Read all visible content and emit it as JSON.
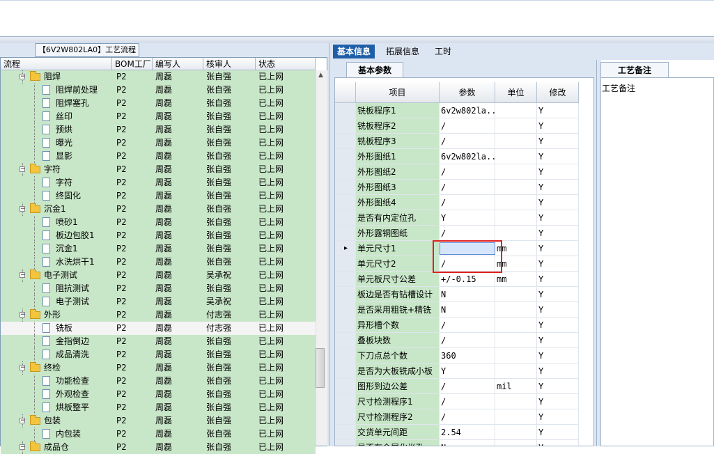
{
  "left_panel": {
    "tab_title": "【6V2W802LA0】工艺流程",
    "columns": [
      "流程",
      "BOM工厂",
      "编写人",
      "核审人",
      "状态"
    ],
    "rows": [
      {
        "name": "阻焊",
        "level": 1,
        "type": "folder",
        "bom": "P2",
        "writer": "周磊",
        "reviewer": "张自强",
        "status": "已上网"
      },
      {
        "name": "阻焊前处理",
        "level": 2,
        "type": "doc",
        "bom": "P2",
        "writer": "周磊",
        "reviewer": "张自强",
        "status": "已上网"
      },
      {
        "name": "阻焊塞孔",
        "level": 2,
        "type": "doc",
        "bom": "P2",
        "writer": "周磊",
        "reviewer": "张自强",
        "status": "已上网"
      },
      {
        "name": "丝印",
        "level": 2,
        "type": "doc",
        "bom": "P2",
        "writer": "周磊",
        "reviewer": "张自强",
        "status": "已上网"
      },
      {
        "name": "预烘",
        "level": 2,
        "type": "doc",
        "bom": "P2",
        "writer": "周磊",
        "reviewer": "张自强",
        "status": "已上网"
      },
      {
        "name": "曝光",
        "level": 2,
        "type": "doc",
        "bom": "P2",
        "writer": "周磊",
        "reviewer": "张自强",
        "status": "已上网"
      },
      {
        "name": "显影",
        "level": 2,
        "type": "doc",
        "bom": "P2",
        "writer": "周磊",
        "reviewer": "张自强",
        "status": "已上网"
      },
      {
        "name": "字符",
        "level": 1,
        "type": "folder",
        "bom": "P2",
        "writer": "周磊",
        "reviewer": "张自强",
        "status": "已上网"
      },
      {
        "name": "字符",
        "level": 2,
        "type": "doc",
        "bom": "P2",
        "writer": "周磊",
        "reviewer": "张自强",
        "status": "已上网"
      },
      {
        "name": "终固化",
        "level": 2,
        "type": "doc",
        "bom": "P2",
        "writer": "周磊",
        "reviewer": "张自强",
        "status": "已上网"
      },
      {
        "name": "沉金1",
        "level": 1,
        "type": "folder",
        "bom": "P2",
        "writer": "周磊",
        "reviewer": "张自强",
        "status": "已上网"
      },
      {
        "name": "喷砂1",
        "level": 2,
        "type": "doc",
        "bom": "P2",
        "writer": "周磊",
        "reviewer": "张自强",
        "status": "已上网"
      },
      {
        "name": "板边包胶1",
        "level": 2,
        "type": "doc",
        "bom": "P2",
        "writer": "周磊",
        "reviewer": "张自强",
        "status": "已上网"
      },
      {
        "name": "沉金1",
        "level": 2,
        "type": "doc",
        "bom": "P2",
        "writer": "周磊",
        "reviewer": "张自强",
        "status": "已上网"
      },
      {
        "name": "水洗烘干1",
        "level": 2,
        "type": "doc",
        "bom": "P2",
        "writer": "周磊",
        "reviewer": "张自强",
        "status": "已上网"
      },
      {
        "name": "电子测试",
        "level": 1,
        "type": "folder",
        "bom": "P2",
        "writer": "周磊",
        "reviewer": "吴承祝",
        "status": "已上网"
      },
      {
        "name": "阻抗测试",
        "level": 2,
        "type": "doc",
        "bom": "P2",
        "writer": "周磊",
        "reviewer": "张自强",
        "status": "已上网"
      },
      {
        "name": "电子测试",
        "level": 2,
        "type": "doc",
        "bom": "P2",
        "writer": "周磊",
        "reviewer": "吴承祝",
        "status": "已上网"
      },
      {
        "name": "外形",
        "level": 1,
        "type": "folder",
        "bom": "P2",
        "writer": "周磊",
        "reviewer": "付志强",
        "status": "已上网"
      },
      {
        "name": "铣板",
        "level": 2,
        "type": "doc",
        "bom": "P2",
        "writer": "周磊",
        "reviewer": "付志强",
        "status": "已上网",
        "selected": true
      },
      {
        "name": "金指倒边",
        "level": 2,
        "type": "doc",
        "bom": "P2",
        "writer": "周磊",
        "reviewer": "张自强",
        "status": "已上网"
      },
      {
        "name": "成品清洗",
        "level": 2,
        "type": "doc",
        "bom": "P2",
        "writer": "周磊",
        "reviewer": "张自强",
        "status": "已上网"
      },
      {
        "name": "终检",
        "level": 1,
        "type": "folder",
        "bom": "P2",
        "writer": "周磊",
        "reviewer": "张自强",
        "status": "已上网"
      },
      {
        "name": "功能检查",
        "level": 2,
        "type": "doc",
        "bom": "P2",
        "writer": "周磊",
        "reviewer": "张自强",
        "status": "已上网"
      },
      {
        "name": "外观检查",
        "level": 2,
        "type": "doc",
        "bom": "P2",
        "writer": "周磊",
        "reviewer": "张自强",
        "status": "已上网"
      },
      {
        "name": "烘板整平",
        "level": 2,
        "type": "doc",
        "bom": "P2",
        "writer": "周磊",
        "reviewer": "张自强",
        "status": "已上网"
      },
      {
        "name": "包装",
        "level": 1,
        "type": "folder",
        "bom": "P2",
        "writer": "周磊",
        "reviewer": "张自强",
        "status": "已上网"
      },
      {
        "name": "内包装",
        "level": 2,
        "type": "doc",
        "bom": "P2",
        "writer": "周磊",
        "reviewer": "张自强",
        "status": "已上网"
      },
      {
        "name": "成品仓",
        "level": 1,
        "type": "folder",
        "bom": "P2",
        "writer": "周磊",
        "reviewer": "张自强",
        "status": "已上网"
      }
    ]
  },
  "right_tabs": [
    "基本信息",
    "拓展信息",
    "工时"
  ],
  "center": {
    "tab_title": "基本参数",
    "columns": [
      "项目",
      "参数",
      "单位",
      "修改"
    ],
    "rows": [
      {
        "item": "铣板程序1",
        "param": "6v2w802la...",
        "unit": "",
        "modify": "Y"
      },
      {
        "item": "铣板程序2",
        "param": "/",
        "unit": "",
        "modify": "Y"
      },
      {
        "item": "铣板程序3",
        "param": "/",
        "unit": "",
        "modify": "Y"
      },
      {
        "item": "外形图纸1",
        "param": "6v2w802la...",
        "unit": "",
        "modify": "Y"
      },
      {
        "item": "外形图纸2",
        "param": "/",
        "unit": "",
        "modify": "Y"
      },
      {
        "item": "外形图纸3",
        "param": "/",
        "unit": "",
        "modify": "Y"
      },
      {
        "item": "外形图纸4",
        "param": "/",
        "unit": "",
        "modify": "Y"
      },
      {
        "item": "是否有内定位孔",
        "param": "Y",
        "unit": "",
        "modify": "Y"
      },
      {
        "item": "外形露铜图纸",
        "param": "/",
        "unit": "",
        "modify": "Y"
      },
      {
        "item": "单元尺寸1",
        "param": "/",
        "unit": "mm",
        "modify": "Y",
        "current": true
      },
      {
        "item": "单元尺寸2",
        "param": "/",
        "unit": "mm",
        "modify": "Y"
      },
      {
        "item": "单元板尺寸公差",
        "param": "+/-0.15",
        "unit": "mm",
        "modify": "Y"
      },
      {
        "item": "板边是否有钻槽设计",
        "param": "N",
        "unit": "",
        "modify": "Y"
      },
      {
        "item": "是否采用粗铣+精铣",
        "param": "N",
        "unit": "",
        "modify": "Y"
      },
      {
        "item": "异形槽个数",
        "param": "/",
        "unit": "",
        "modify": "Y"
      },
      {
        "item": "叠板块数",
        "param": "/",
        "unit": "",
        "modify": "Y"
      },
      {
        "item": "下刀点总个数",
        "param": "360",
        "unit": "",
        "modify": "Y"
      },
      {
        "item": "是否为大板铣成小板",
        "param": "Y",
        "unit": "",
        "modify": "Y"
      },
      {
        "item": "图形到边公差",
        "param": "/",
        "unit": "mil",
        "modify": "Y"
      },
      {
        "item": "尺寸检测程序1",
        "param": "/",
        "unit": "",
        "modify": "Y"
      },
      {
        "item": "尺寸检测程序2",
        "param": "/",
        "unit": "",
        "modify": "Y"
      },
      {
        "item": "交货单元间距",
        "param": "2.54",
        "unit": "",
        "modify": "Y"
      },
      {
        "item": "是否有金属化半孔",
        "param": "N",
        "unit": "",
        "modify": "Y"
      }
    ]
  },
  "notes": {
    "tab_title": "工艺备注",
    "label": "工艺备注"
  },
  "colors": {
    "row_green": "#c8e6c8",
    "tab_active": "#1f5fa8",
    "highlight_red": "#e0201f"
  }
}
